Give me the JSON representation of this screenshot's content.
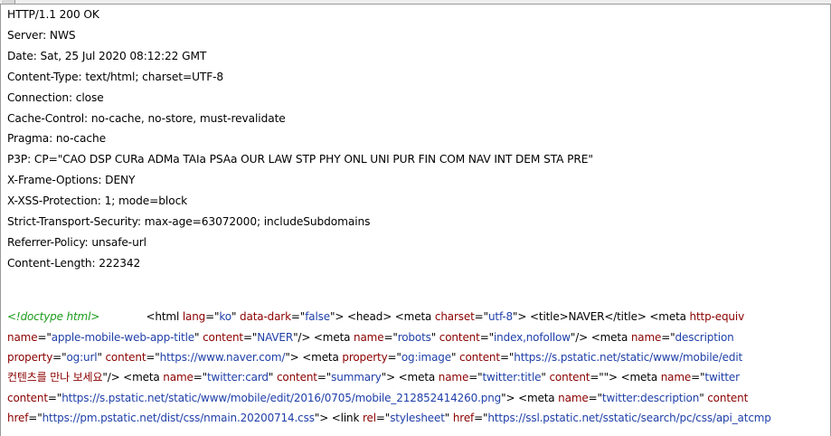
{
  "response_headers": [
    "HTTP/1.1 200 OK",
    "Server: NWS",
    "Date: Sat, 25 Jul 2020 08:12:22 GMT",
    "Content-Type: text/html; charset=UTF-8",
    "Connection: close",
    "Cache-Control: no-cache, no-store, must-revalidate",
    "Pragma: no-cache",
    "P3P: CP=\"CAO DSP CURa ADMa TAIa PSAa OUR LAW STP PHY ONL UNI PUR FIN COM NAV INT DEM STA PRE\"",
    "X-Frame-Options: DENY",
    "X-XSS-Protection: 1; mode=block",
    "Strict-Transport-Security: max-age=63072000; includeSubdomains",
    "Referrer-Policy: unsafe-url",
    "Content-Length: 222342"
  ],
  "body_lines": [
    [
      {
        "t": "doctype",
        "s": "<!doctype html>"
      },
      {
        "t": "plain",
        "s": "              "
      },
      {
        "t": "tag",
        "s": "<html "
      },
      {
        "t": "attr",
        "s": "lang"
      },
      {
        "t": "tag",
        "s": "=\""
      },
      {
        "t": "val",
        "s": "ko"
      },
      {
        "t": "tag",
        "s": "\" "
      },
      {
        "t": "attr",
        "s": "data-dark"
      },
      {
        "t": "tag",
        "s": "=\""
      },
      {
        "t": "val",
        "s": "false"
      },
      {
        "t": "tag",
        "s": "\"> <head> <meta "
      },
      {
        "t": "attr",
        "s": "charset"
      },
      {
        "t": "tag",
        "s": "=\""
      },
      {
        "t": "val",
        "s": "utf-8"
      },
      {
        "t": "tag",
        "s": "\"> <title>"
      },
      {
        "t": "plain",
        "s": "NAVER"
      },
      {
        "t": "tag",
        "s": "</title> <meta "
      },
      {
        "t": "attr",
        "s": "http-equiv"
      }
    ],
    [
      {
        "t": "attr",
        "s": "name"
      },
      {
        "t": "tag",
        "s": "=\""
      },
      {
        "t": "val",
        "s": "apple-mobile-web-app-title"
      },
      {
        "t": "tag",
        "s": "\" "
      },
      {
        "t": "attr",
        "s": "content"
      },
      {
        "t": "tag",
        "s": "=\""
      },
      {
        "t": "val",
        "s": "NAVER"
      },
      {
        "t": "tag",
        "s": "\"/> <meta "
      },
      {
        "t": "attr",
        "s": "name"
      },
      {
        "t": "tag",
        "s": "=\""
      },
      {
        "t": "val",
        "s": "robots"
      },
      {
        "t": "tag",
        "s": "\" "
      },
      {
        "t": "attr",
        "s": "content"
      },
      {
        "t": "tag",
        "s": "=\""
      },
      {
        "t": "val",
        "s": "index,nofollow"
      },
      {
        "t": "tag",
        "s": "\"/> <meta "
      },
      {
        "t": "attr",
        "s": "name"
      },
      {
        "t": "tag",
        "s": "=\""
      },
      {
        "t": "val",
        "s": "description"
      }
    ],
    [
      {
        "t": "attr",
        "s": "property"
      },
      {
        "t": "tag",
        "s": "=\""
      },
      {
        "t": "val",
        "s": "og:url"
      },
      {
        "t": "tag",
        "s": "\" "
      },
      {
        "t": "attr",
        "s": "content"
      },
      {
        "t": "tag",
        "s": "=\""
      },
      {
        "t": "val",
        "s": "https://www.naver.com/"
      },
      {
        "t": "tag",
        "s": "\"> <meta "
      },
      {
        "t": "attr",
        "s": "property"
      },
      {
        "t": "tag",
        "s": "=\""
      },
      {
        "t": "val",
        "s": "og:image"
      },
      {
        "t": "tag",
        "s": "\" "
      },
      {
        "t": "attr",
        "s": "content"
      },
      {
        "t": "tag",
        "s": "=\""
      },
      {
        "t": "val",
        "s": "https://s.pstatic.net/static/www/mobile/edit"
      }
    ],
    [
      {
        "t": "kr",
        "s": "컨텐츠를 만나 보세요"
      },
      {
        "t": "tag",
        "s": "\"/> <meta "
      },
      {
        "t": "attr",
        "s": "name"
      },
      {
        "t": "tag",
        "s": "=\""
      },
      {
        "t": "val",
        "s": "twitter:card"
      },
      {
        "t": "tag",
        "s": "\" "
      },
      {
        "t": "attr",
        "s": "content"
      },
      {
        "t": "tag",
        "s": "=\""
      },
      {
        "t": "val",
        "s": "summary"
      },
      {
        "t": "tag",
        "s": "\"> <meta "
      },
      {
        "t": "attr",
        "s": "name"
      },
      {
        "t": "tag",
        "s": "=\""
      },
      {
        "t": "val",
        "s": "twitter:title"
      },
      {
        "t": "tag",
        "s": "\" "
      },
      {
        "t": "attr",
        "s": "content"
      },
      {
        "t": "tag",
        "s": "=\"\"> <meta "
      },
      {
        "t": "attr",
        "s": "name"
      },
      {
        "t": "tag",
        "s": "=\""
      },
      {
        "t": "val",
        "s": "twitter"
      }
    ],
    [
      {
        "t": "attr",
        "s": "content"
      },
      {
        "t": "tag",
        "s": "=\""
      },
      {
        "t": "val",
        "s": "https://s.pstatic.net/static/www/mobile/edit/2016/0705/mobile_212852414260.png"
      },
      {
        "t": "tag",
        "s": "\"> <meta "
      },
      {
        "t": "attr",
        "s": "name"
      },
      {
        "t": "tag",
        "s": "=\""
      },
      {
        "t": "val",
        "s": "twitter:description"
      },
      {
        "t": "tag",
        "s": "\" "
      },
      {
        "t": "attr",
        "s": "content"
      }
    ],
    [
      {
        "t": "attr",
        "s": "href"
      },
      {
        "t": "tag",
        "s": "=\""
      },
      {
        "t": "val",
        "s": "https://pm.pstatic.net/dist/css/nmain.20200714.css"
      },
      {
        "t": "tag",
        "s": "\"> <link "
      },
      {
        "t": "attr",
        "s": "rel"
      },
      {
        "t": "tag",
        "s": "=\""
      },
      {
        "t": "val",
        "s": "stylesheet"
      },
      {
        "t": "tag",
        "s": "\" "
      },
      {
        "t": "attr",
        "s": "href"
      },
      {
        "t": "tag",
        "s": "=\""
      },
      {
        "t": "val",
        "s": "https://ssl.pstatic.net/sstatic/search/pc/css/api_atcmp"
      }
    ]
  ],
  "colors": {
    "doctype": "#1c9c1c",
    "attr": "#8b0000",
    "value": "#1f3fa8",
    "text": "#000000",
    "background": "#ffffff"
  }
}
